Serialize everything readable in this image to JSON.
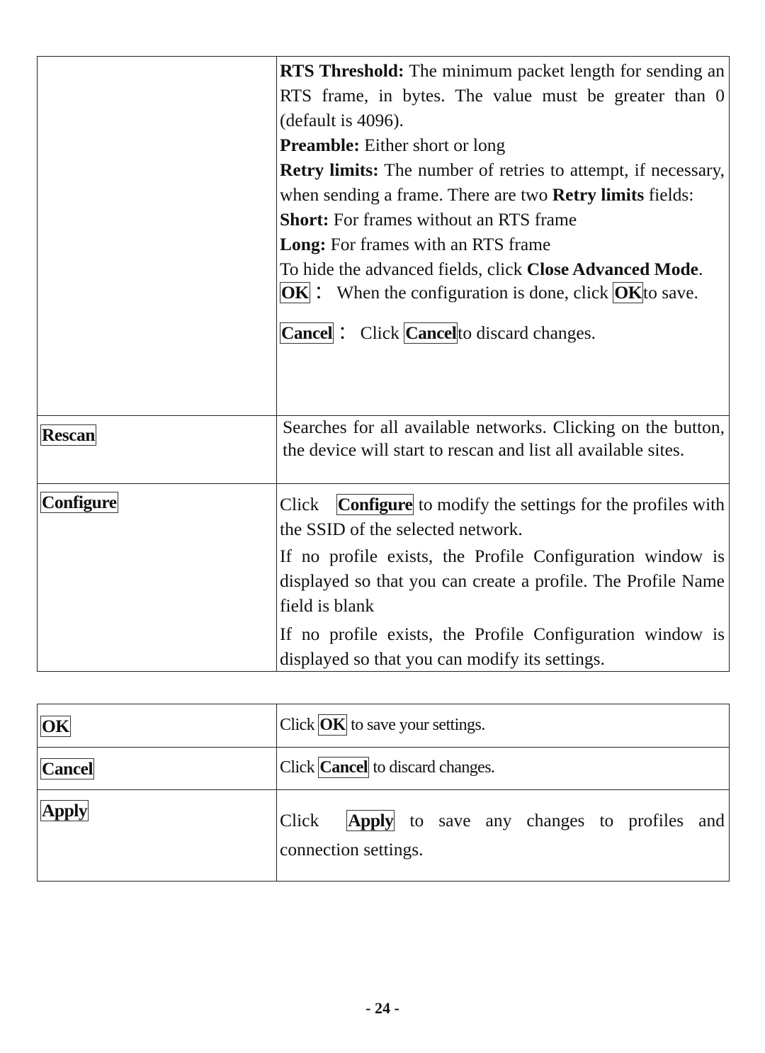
{
  "table1": {
    "row1": {
      "left_label": "",
      "rts_label": "RTS Threshold:",
      "rts_text": " The minimum packet length for sending an RTS frame, in bytes. The value must be greater than 0 (default is 4096).",
      "preamble_label": "Preamble:",
      "preamble_text": " Either short or long",
      "retry_label": "Retry limits:",
      "retry_text_1": " The number of retries to attempt, if necessary, when sending a frame. There are two ",
      "retry_bold_2": "Retry limits",
      "retry_text_2": " fields:",
      "short_label": "Short:",
      "short_text": " For frames without an RTS frame",
      "long_label": "Long:",
      "long_text": " For frames with an RTS frame",
      "hide_text": "To hide the advanced fields, click ",
      "hide_bold": "Close Advanced Mode",
      "hide_end": ".",
      "ok_button": "OK",
      "ok_colon": "：",
      "ok_text_1": "When the configuration is done, click ",
      "ok_button_inline": "OK ",
      "ok_text_2": "to save.",
      "cancel_button": "Cancel",
      "cancel_colon": "：",
      "cancel_text_1": "Click ",
      "cancel_button_inline": "Cancel ",
      "cancel_text_2": "to discard changes."
    },
    "row2": {
      "button": "Rescan",
      "description": "Searches for all available networks. Clicking on the button, the device will start to rescan and list all available sites."
    },
    "row3": {
      "button": "Configure",
      "desc_1_pre": "Click ",
      "desc_1_button": "Configure",
      "desc_1_post": " to modify the settings for the profiles with the SSID of the selected network.",
      "desc_2": "If no profile exists, the Profile Configuration window is displayed so that you can create a profile. The Profile Name field is blank",
      "desc_3": "If no profile exists, the Profile Configuration window is displayed so that you can modify its settings."
    }
  },
  "table2": {
    "rows": [
      {
        "button": "OK",
        "pre": "Click ",
        "inline_button": "OK",
        "post": " to save your settings."
      },
      {
        "button": "Cancel",
        "pre": "Click ",
        "inline_button": "Cancel",
        "post": " to discard changes."
      },
      {
        "button": "Apply",
        "pre": "Click ",
        "inline_button": "Apply",
        "post": " to save any changes to profiles and connection settings."
      }
    ]
  },
  "footer": {
    "page_number": "- 24 -"
  }
}
